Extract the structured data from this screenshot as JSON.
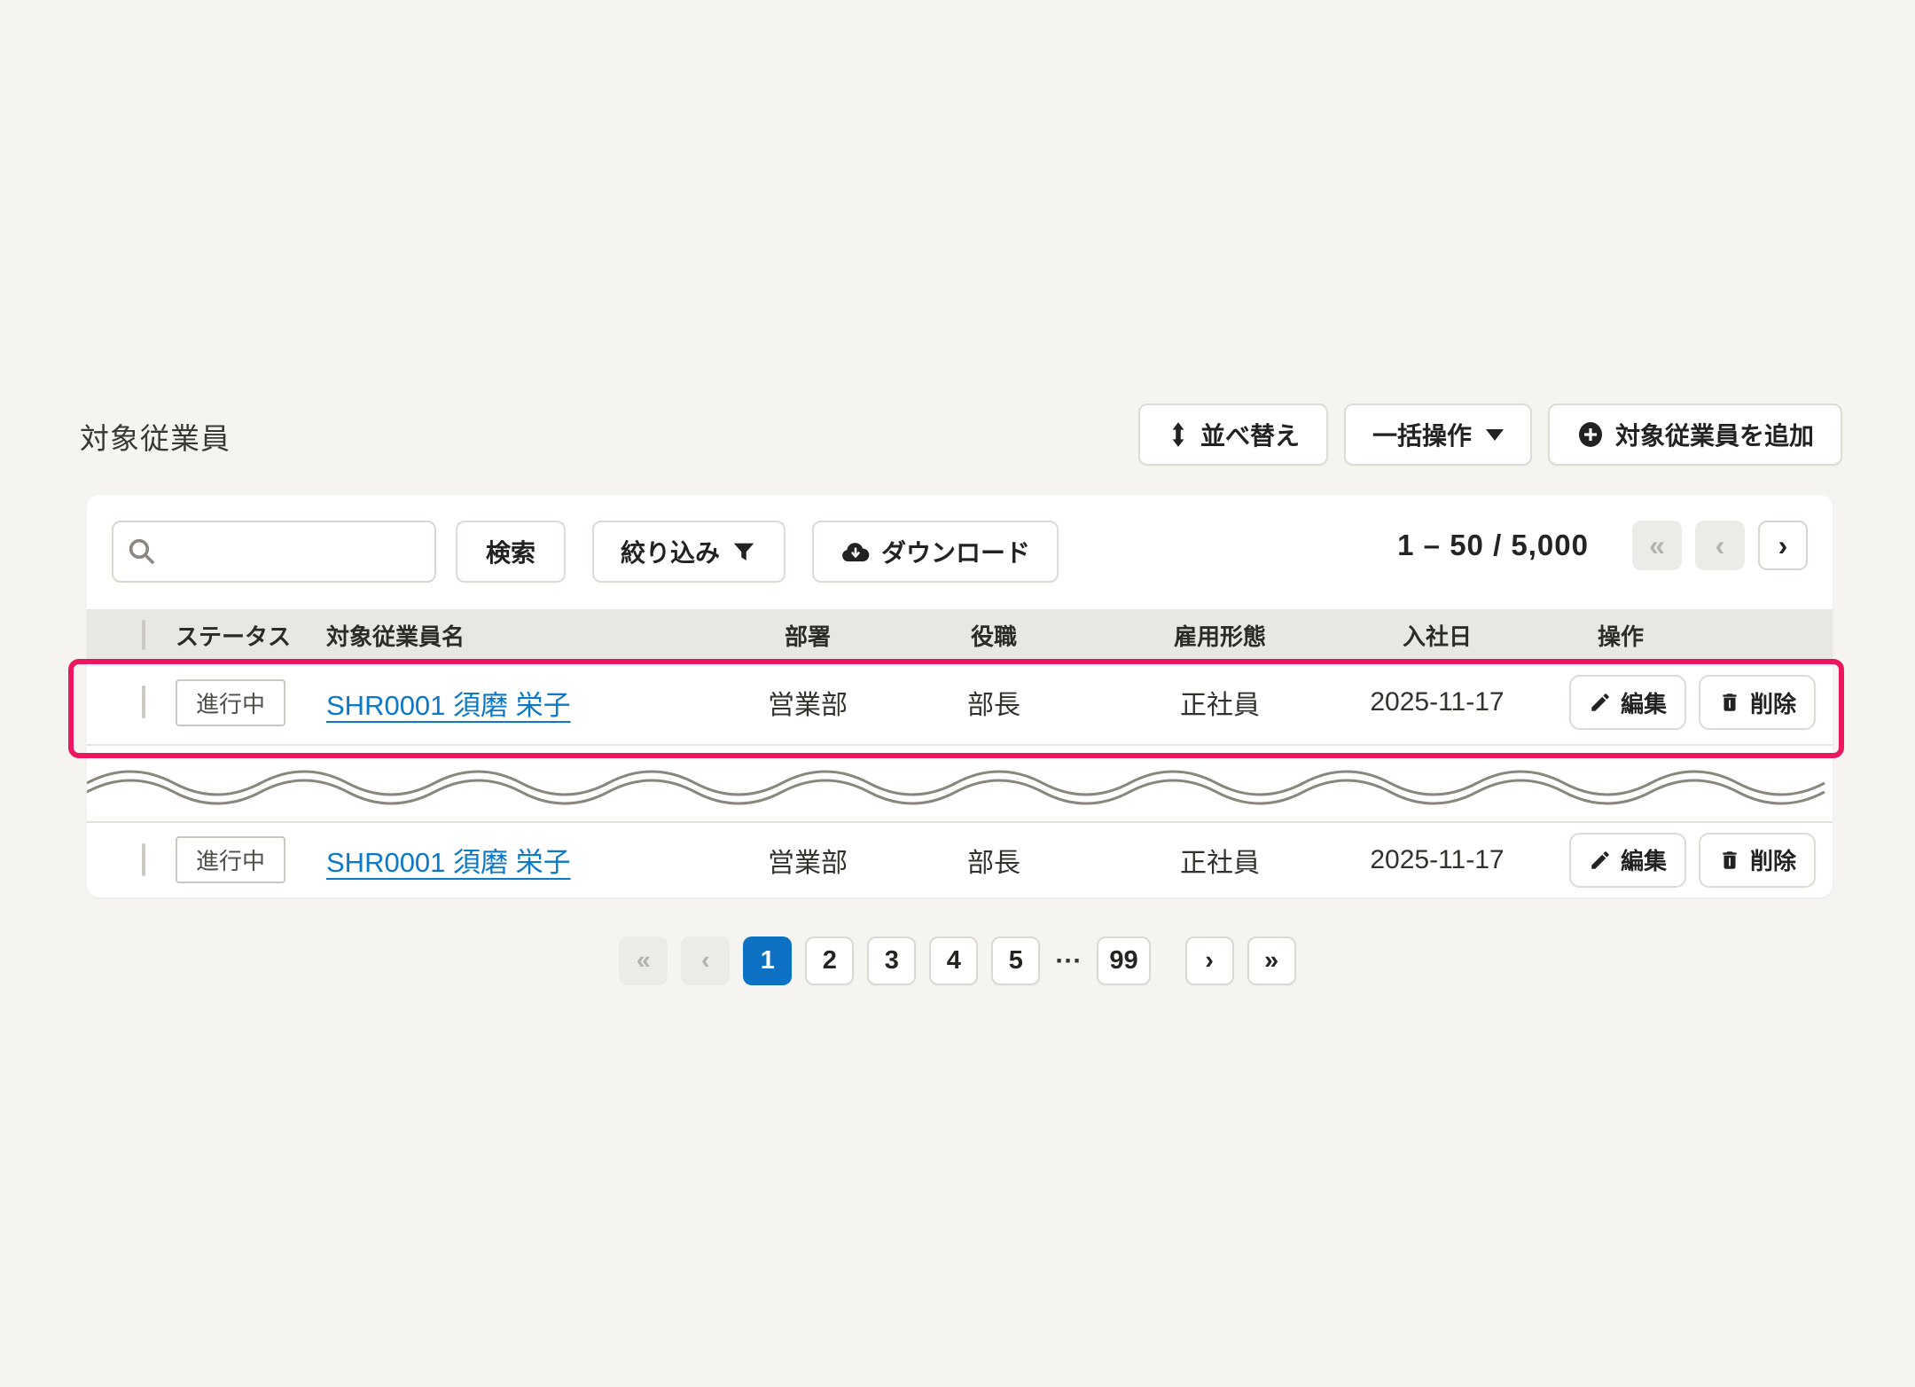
{
  "page_title": "対象従業員",
  "toolbar": {
    "sort_label": "並べ替え",
    "bulk_label": "一括操作",
    "add_label": "対象従業員を追加"
  },
  "filters": {
    "search_button": "検索",
    "filter_button": "絞り込み",
    "download_button": "ダウンロード",
    "search_value": ""
  },
  "range": {
    "info": "1 – 50 / 5,000",
    "first_icon": "«",
    "prev_icon": "‹",
    "next_icon": "›"
  },
  "table": {
    "headers": [
      "ステータス",
      "対象従業員名",
      "部署",
      "役職",
      "雇用形態",
      "入社日",
      "操作"
    ],
    "rows": [
      {
        "status": "進行中",
        "name": "SHR0001 須磨 栄子",
        "department": "営業部",
        "position": "部長",
        "employment": "正社員",
        "join_date": "2025-11-17",
        "edit_label": "編集",
        "delete_label": "削除"
      },
      {
        "status": "進行中",
        "name": "SHR0001 須磨 栄子",
        "department": "営業部",
        "position": "部長",
        "employment": "正社員",
        "join_date": "2025-11-17",
        "edit_label": "編集",
        "delete_label": "削除"
      }
    ]
  },
  "pagination": {
    "first_icon": "«",
    "prev_icon": "‹",
    "pages": [
      "1",
      "2",
      "3",
      "4",
      "5"
    ],
    "ellipsis": "···",
    "last_page": "99",
    "next_icon": "›",
    "last_icon": "»"
  },
  "colors": {
    "highlight_pink": "#ec1660",
    "link_blue": "#0b78c8",
    "active_page_blue": "#0d72c4"
  }
}
